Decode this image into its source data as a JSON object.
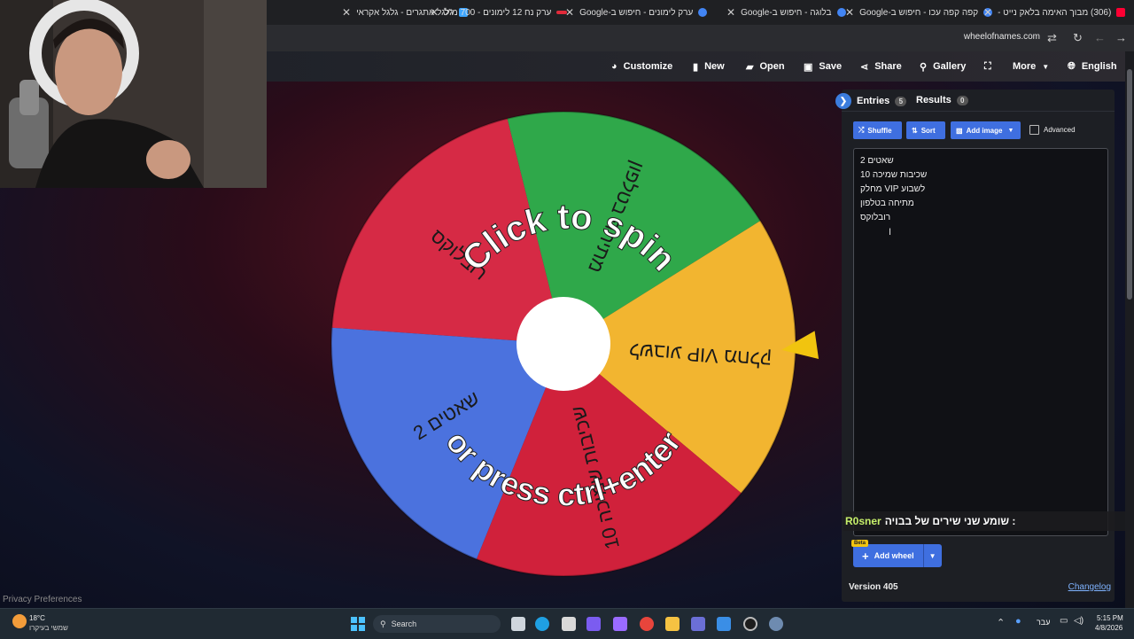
{
  "browser": {
    "tabs": [
      {
        "title": "גלגל אתגרים - גלגל אקראי",
        "color": "#3ea6ff"
      },
      {
        "title": "ערק נח 12 לימונים - 700 מ\"ל",
        "color": "#e02a3a"
      },
      {
        "title": "ערק לימונים - חיפוש ב-Google",
        "color": "#4285f4"
      },
      {
        "title": "בלוגה - חיפוש ב-Google",
        "color": "#4285f4"
      },
      {
        "title": "קפה קפה עכו - חיפוש ב-Google",
        "color": "#4285f4"
      },
      {
        "title": "(306) מבוך האימה בלאק נייט -",
        "color": "#ff0033"
      }
    ],
    "url": "wheelofnames.com"
  },
  "toolbar": {
    "customize": "Customize",
    "new": "New",
    "open": "Open",
    "save": "Save",
    "share": "Share",
    "gallery": "Gallery",
    "more": "More",
    "language": "English"
  },
  "wheel": {
    "center_color": "#ffffff",
    "segments": [
      {
        "label": "רובלוקס",
        "color": "#d62a45"
      },
      {
        "label": "מתיחה בטלפון",
        "color": "#2fa84a"
      },
      {
        "label": "לשבוע VIP מחלק",
        "color": "#f2b530"
      },
      {
        "label": "שכיבות שמיכה 10",
        "color": "#d0213b"
      },
      {
        "label": "שאטים 2",
        "color": "#4b72de"
      }
    ],
    "prompt_top": "Click to spin",
    "prompt_bottom": "or press ctrl+enter"
  },
  "panel": {
    "entries_label": "Entries",
    "entries_count": "5",
    "results_label": "Results",
    "results_count": "0",
    "shuffle": "Shuffle",
    "sort": "Sort",
    "add_image": "Add image",
    "advanced": "Advanced",
    "entries": [
      "שאטים 2",
      "שכיבות שמיכה 10",
      "לשבוע VIP מחלק",
      "מתיחה בטלפון",
      "רובלוקס"
    ],
    "add_wheel": "Add wheel",
    "beta": "Beta",
    "version": "Version 405",
    "changelog": "Changelog"
  },
  "chat": {
    "user": "R0sner",
    "message": ": שומע שני שירים של בבויה"
  },
  "privacy": "Privacy Preferences",
  "taskbar": {
    "weather_temp": "18°C",
    "weather_desc": "שמשי בעיקרו",
    "search": "Search",
    "lang": "עבר",
    "time": "5:15 PM",
    "date": "4/8/2026"
  },
  "colors": {
    "accent": "#3f6fe0",
    "pointer": "#f1c40f"
  }
}
